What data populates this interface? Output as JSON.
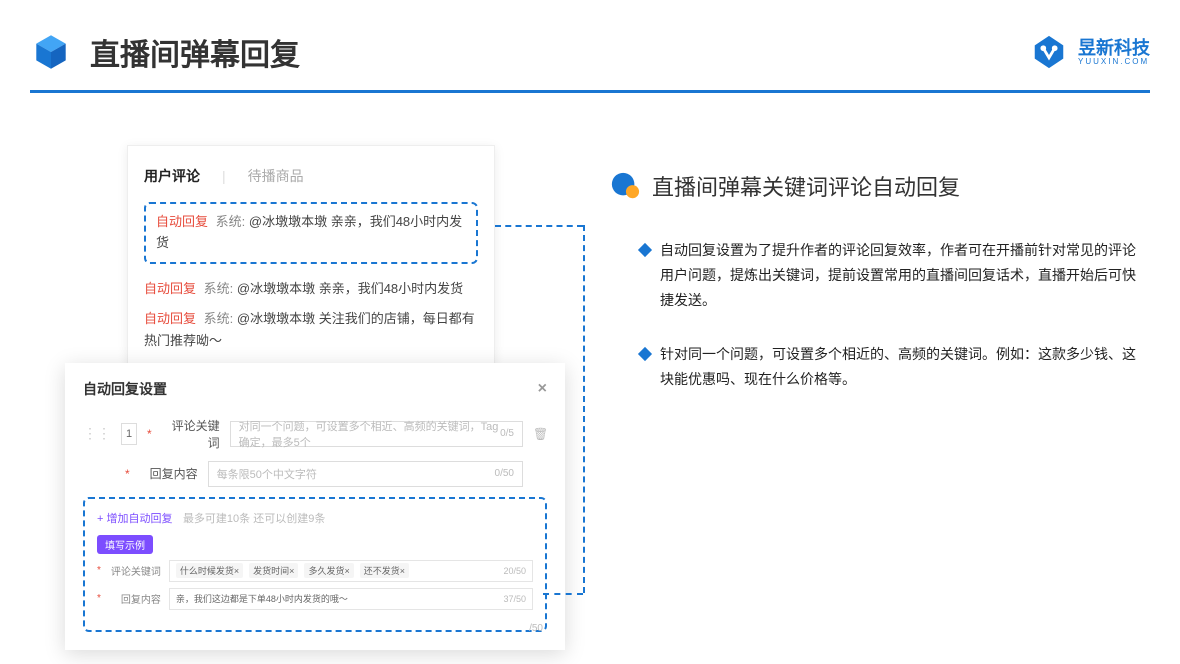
{
  "header": {
    "title": "直播间弹幕回复",
    "logo_cn": "昱新科技",
    "logo_en": "YUUXIN.COM"
  },
  "comment_panel": {
    "tab_active": "用户评论",
    "tab_inactive": "待播商品",
    "highlight": {
      "tag": "自动回复",
      "system": "系统:",
      "body": "@冰墩墩本墩 亲亲，我们48小时内发货"
    },
    "lines": [
      {
        "tag": "自动回复",
        "system": "系统:",
        "body": "@冰墩墩本墩 亲亲，我们48小时内发货"
      },
      {
        "tag": "自动回复",
        "system": "系统:",
        "body": "@冰墩墩本墩 关注我们的店铺，每日都有热门推荐呦～"
      }
    ]
  },
  "modal": {
    "title": "自动回复设置",
    "row_num": "1",
    "keyword_label": "评论关键词",
    "keyword_placeholder": "对同一个问题，可设置多个相近、高频的关键词，Tag确定，最多5个",
    "keyword_count": "0/5",
    "content_label": "回复内容",
    "content_placeholder": "每条限50个中文字符",
    "content_count": "0/50",
    "add_link": "+ 增加自动回复",
    "add_hint": "最多可建10条 还可以创建9条",
    "example_badge": "填写示例",
    "ex_kw_label": "评论关键词",
    "ex_tags": [
      "什么时候发货×",
      "发货时间×",
      "多久发货×",
      "还不发货×"
    ],
    "ex_kw_count": "20/50",
    "ex_content_label": "回复内容",
    "ex_content_text": "亲，我们这边都是下单48小时内发货的哦～",
    "ex_content_count": "37/50",
    "extra_count": "/50"
  },
  "right": {
    "section_title": "直播间弹幕关键词评论自动回复",
    "bullets": [
      "自动回复设置为了提升作者的评论回复效率，作者可在开播前针对常见的评论用户问题，提炼出关键词，提前设置常用的直播间回复话术，直播开始后可快捷发送。",
      "针对同一个问题，可设置多个相近的、高频的关键词。例如：这款多少钱、这块能优惠吗、现在什么价格等。"
    ]
  }
}
